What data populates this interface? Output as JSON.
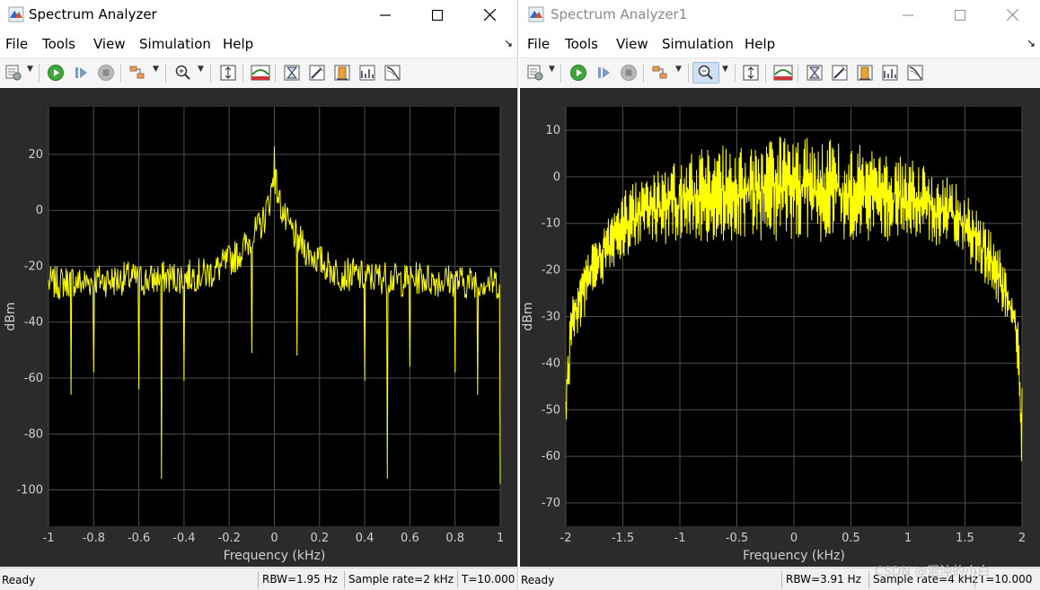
{
  "colors": {
    "trace": "#ffff00",
    "axes_bg": "#000000",
    "grid": "#4d4d4d",
    "plot_bg": "#2b2b2b",
    "tick": "#cfcfcf"
  },
  "windows": [
    {
      "title": "Spectrum Analyzer",
      "menu": [
        "File",
        "Tools",
        "View",
        "Simulation",
        "Help"
      ],
      "menu_arrow": "↘",
      "title_buttons": {
        "minimize": "minimize-icon",
        "maximize": "maximize-icon",
        "close": "close-icon"
      },
      "toolbar_icons": [
        "settings-icon",
        "run-icon",
        "step-forward-icon",
        "stop-icon",
        "highlight-icon",
        "zoom-in-icon",
        "scale-axes-icon",
        "trace-icon",
        "cursor-icon",
        "peak-finder-icon",
        "channel-measure-icon",
        "distortion-icon",
        "ccdf-icon"
      ],
      "status": {
        "ready": "Ready",
        "rbw": "RBW=1.95 Hz",
        "sample_rate": "Sample rate=2 kHz",
        "time": "T=10.000"
      },
      "chart_data": {
        "type": "line",
        "xlabel": "Frequency (kHz)",
        "ylabel": "dBm",
        "xlim": [
          -1,
          1
        ],
        "ylim": [
          -113,
          37
        ],
        "x_ticks": [
          -1,
          -0.8,
          -0.6,
          -0.4,
          -0.2,
          0,
          0.2,
          0.4,
          0.6,
          0.8,
          1
        ],
        "y_ticks": [
          20,
          0,
          -20,
          -40,
          -60,
          -80,
          -100
        ],
        "grid": true,
        "series": [
          {
            "x": [
              -1,
              -0.95,
              -0.9,
              -0.85,
              -0.8,
              -0.75,
              -0.7,
              -0.65,
              -0.6,
              -0.55,
              -0.5,
              -0.45,
              -0.4,
              -0.35,
              -0.3,
              -0.25,
              -0.2,
              -0.15,
              -0.1,
              -0.05,
              -0.02,
              0,
              0.02,
              0.05,
              0.1,
              0.15,
              0.2,
              0.25,
              0.3,
              0.35,
              0.4,
              0.45,
              0.5,
              0.55,
              0.6,
              0.65,
              0.7,
              0.75,
              0.8,
              0.85,
              0.9,
              0.95,
              1
            ],
            "y": [
              -26,
              -26,
              -25,
              -26,
              -25,
              -25,
              -25,
              -24,
              -25,
              -25,
              -24,
              -24,
              -24,
              -23,
              -23,
              -21,
              -18,
              -15,
              -10,
              -4,
              4,
              13,
              4,
              -4,
              -10,
              -15,
              -18,
              -21,
              -23,
              -23,
              -24,
              -24,
              -24,
              -25,
              -25,
              -24,
              -25,
              -25,
              -25,
              -26,
              -25,
              -26,
              -26
            ],
            "nulls": [
              {
                "x": -0.9,
                "y": -66
              },
              {
                "x": -0.8,
                "y": -58
              },
              {
                "x": -0.6,
                "y": -64
              },
              {
                "x": -0.5,
                "y": -96
              },
              {
                "x": -0.4,
                "y": -61
              },
              {
                "x": -0.1,
                "y": -51
              },
              {
                "x": 0.1,
                "y": -52
              },
              {
                "x": 0.4,
                "y": -61
              },
              {
                "x": 0.5,
                "y": -96
              },
              {
                "x": 0.6,
                "y": -56
              },
              {
                "x": 0.8,
                "y": -58
              },
              {
                "x": 0.9,
                "y": -66
              },
              {
                "x": 1,
                "y": -98
              }
            ],
            "peak": {
              "x": 0,
              "y": 23
            }
          }
        ]
      }
    },
    {
      "title": "Spectrum Analyzer1",
      "menu": [
        "File",
        "Tools",
        "View",
        "Simulation",
        "Help"
      ],
      "menu_arrow": "↘",
      "title_buttons": {
        "minimize": "minimize-icon",
        "maximize": "maximize-icon",
        "close": "close-icon"
      },
      "toolbar_icons": [
        "settings-icon",
        "run-icon",
        "step-forward-icon",
        "stop-icon",
        "highlight-icon",
        "zoom-in-icon",
        "scale-axes-icon",
        "trace-icon",
        "cursor-icon",
        "peak-finder-icon",
        "channel-measure-icon",
        "distortion-icon",
        "ccdf-icon"
      ],
      "status": {
        "ready": "Ready",
        "rbw": "RBW=3.91 Hz",
        "sample_rate": "Sample rate=4 kHz",
        "time": "T=10.000"
      },
      "chart_data": {
        "type": "line",
        "xlabel": "Frequency (kHz)",
        "ylabel": "dBm",
        "xlim": [
          -2,
          2
        ],
        "ylim": [
          -75,
          15
        ],
        "x_ticks": [
          -2,
          -1.5,
          -1,
          -0.5,
          0,
          0.5,
          1,
          1.5,
          2
        ],
        "y_ticks": [
          10,
          0,
          -10,
          -20,
          -30,
          -40,
          -50,
          -60,
          -70
        ],
        "grid": true,
        "series": [
          {
            "x": [
              -2,
              -1.95,
              -1.9,
              -1.8,
              -1.7,
              -1.6,
              -1.5,
              -1.4,
              -1.2,
              -1,
              -0.8,
              -0.5,
              0,
              0.5,
              0.8,
              1,
              1.2,
              1.4,
              1.5,
              1.6,
              1.7,
              1.8,
              1.9,
              1.95,
              2
            ],
            "upper": [
              -43,
              -25,
              -22,
              -15,
              -10,
              -6,
              -3,
              -1,
              2,
              4,
              6,
              8,
              9,
              8,
              6,
              4,
              2,
              -1,
              -3,
              -6,
              -10,
              -15,
              -22,
              -25,
              -43
            ],
            "lower": [
              -57,
              -38,
              -34,
              -28,
              -24,
              -21,
              -18,
              -16,
              -15,
              -14,
              -14,
              -14,
              -14,
              -14,
              -14,
              -14,
              -15,
              -16,
              -18,
              -21,
              -24,
              -28,
              -34,
              -38,
              -65
            ]
          }
        ]
      }
    }
  ],
  "watermark": "CSDN @混沌的小白"
}
